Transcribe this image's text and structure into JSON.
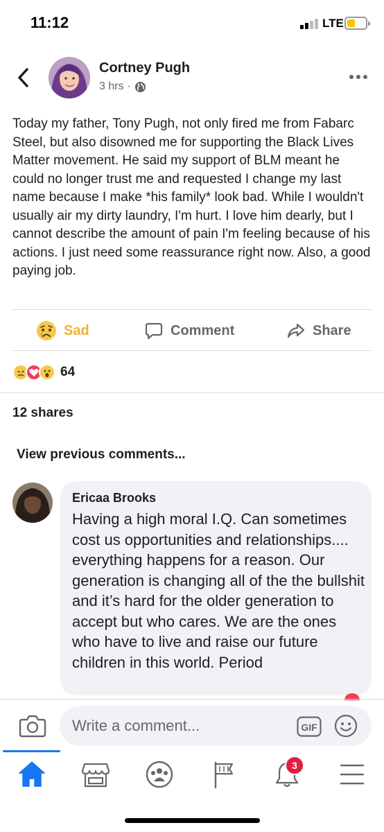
{
  "status_bar": {
    "time": "11:12",
    "network": "LTE",
    "signal_bars_active": 2,
    "battery_color": "#f7c600"
  },
  "post": {
    "author": "Cortney Pugh",
    "time_ago": "3 hrs",
    "separator": "·",
    "privacy_icon": "globe-icon",
    "body": "Today my father, Tony Pugh, not only fired me from Fabarc Steel, but also disowned me for supporting the Black Lives Matter movement. He said my support of BLM meant he could no longer trust me and requested I change my last name because I make *his family* look bad. While I wouldn't usually air my dirty laundry, I'm hurt. I love him dearly, but I cannot describe the amount of pain I'm feeling because of his actions. I just need some reassurance right now. Also, a good paying job."
  },
  "actions": {
    "sad_label": "Sad",
    "comment_label": "Comment",
    "share_label": "Share"
  },
  "reactions": {
    "types": [
      "sad",
      "love",
      "wow"
    ],
    "count": "64"
  },
  "shares": "12 shares",
  "view_previous": "View previous comments...",
  "comment": {
    "author": "Ericaa Brooks",
    "text": "Having a high moral I.Q. Can sometimes cost us opportunities and relationships.... everything happens for a reason. Our generation is changing all of the the bullshit and it’s hard for the older generation to accept but who cares. We are the ones who have to live and raise our future children in this world. Period"
  },
  "composer": {
    "placeholder": "Write a comment...",
    "gif_label": "GIF"
  },
  "nav": {
    "active": "home",
    "notifications_badge": "3"
  },
  "colors": {
    "brand_blue": "#1877f2",
    "sad_yellow": "#f0b030",
    "love_red": "#f33e58",
    "badge_red": "#e41e3f",
    "bubble_gray": "#f0f2f5",
    "meta_gray": "#65676b"
  }
}
